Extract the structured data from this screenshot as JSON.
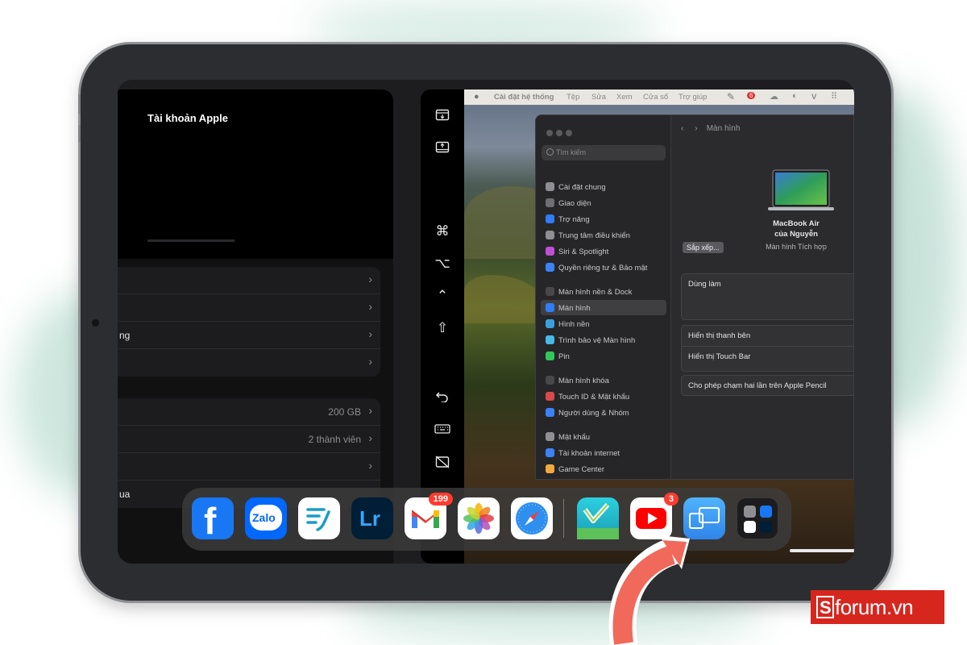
{
  "settings": {
    "account_title": "Tài khoản Apple",
    "group1": [
      {
        "label": "",
        "value": ""
      },
      {
        "label": "",
        "value": ""
      },
      {
        "label": "ng",
        "value": ""
      },
      {
        "label": "",
        "value": ""
      }
    ],
    "group2": [
      {
        "label": "",
        "value": "200 GB"
      },
      {
        "label": "",
        "value": "2 thành viên"
      },
      {
        "label": "",
        "value": ""
      },
      {
        "label": "ua",
        "value": ""
      }
    ]
  },
  "toolbar": {
    "icons": [
      "show-menubar-icon",
      "show-dock-icon",
      "command-icon",
      "option-icon",
      "control-icon",
      "shift-icon",
      "undo-icon",
      "keyboard-icon",
      "disconnect-icon"
    ]
  },
  "mac_menubar": {
    "items": [
      "Cài đặt hệ thống",
      "Tệp",
      "Sửa",
      "Xem",
      "Cửa sổ",
      "Trợ giúp"
    ],
    "badge": "6"
  },
  "system_settings": {
    "search_placeholder": "Tìm kiếm",
    "sidebar": [
      "Cài đặt chung",
      "Giao diện",
      "Trợ năng",
      "Trung tâm điều khiển",
      "Siri & Spotlight",
      "Quyền riêng tư & Bảo mật",
      "Màn hình nền & Dock",
      "Màn hình",
      "Hình nền",
      "Trình bảo vệ Màn hình",
      "Pin",
      "Màn hình khóa",
      "Touch ID & Mật khẩu",
      "Người dùng & Nhóm",
      "Mật khẩu",
      "Tài khoản internet",
      "Game Center"
    ],
    "selected": "Màn hình",
    "nav_title": "Màn hình",
    "display_name": "MacBook Air\ncủa Nguyễn",
    "display_sub": "Màn hình Tích hợp",
    "arrange_button": "Sắp xếp...",
    "use_as": "Dùng làm",
    "show_sidebar": "Hiển thị thanh bên",
    "show_touchbar": "Hiển thị Touch Bar",
    "pencil_double_tap": "Cho phép chạm hai lần trên Apple Pencil"
  },
  "dock": {
    "apps": [
      {
        "name": "Facebook",
        "badge": "",
        "color": "#1877f2"
      },
      {
        "name": "Zalo",
        "badge": "",
        "color": "#0068ff"
      },
      {
        "name": "Notes",
        "badge": "",
        "color": "#ffffff"
      },
      {
        "name": "Lr",
        "badge": "",
        "color": "#001e36"
      },
      {
        "name": "Gmail",
        "badge": "199",
        "color": "#ffffff"
      },
      {
        "name": "Photos",
        "badge": "",
        "color": "#ffffff"
      },
      {
        "name": "Safari",
        "badge": "",
        "color": "#ffffff"
      },
      {
        "name": "Vmoney",
        "badge": "",
        "color": "#1ab0c9"
      },
      {
        "name": "YouTube",
        "badge": "3",
        "color": "#ffffff"
      },
      {
        "name": "Sidecar",
        "badge": "",
        "color": "#3aa0f5"
      },
      {
        "name": "App folder",
        "badge": "",
        "color": "#1c1c1e"
      }
    ]
  },
  "watermark": {
    "text": "forum.vn",
    "mark": "S",
    "color": "#d7261e"
  }
}
